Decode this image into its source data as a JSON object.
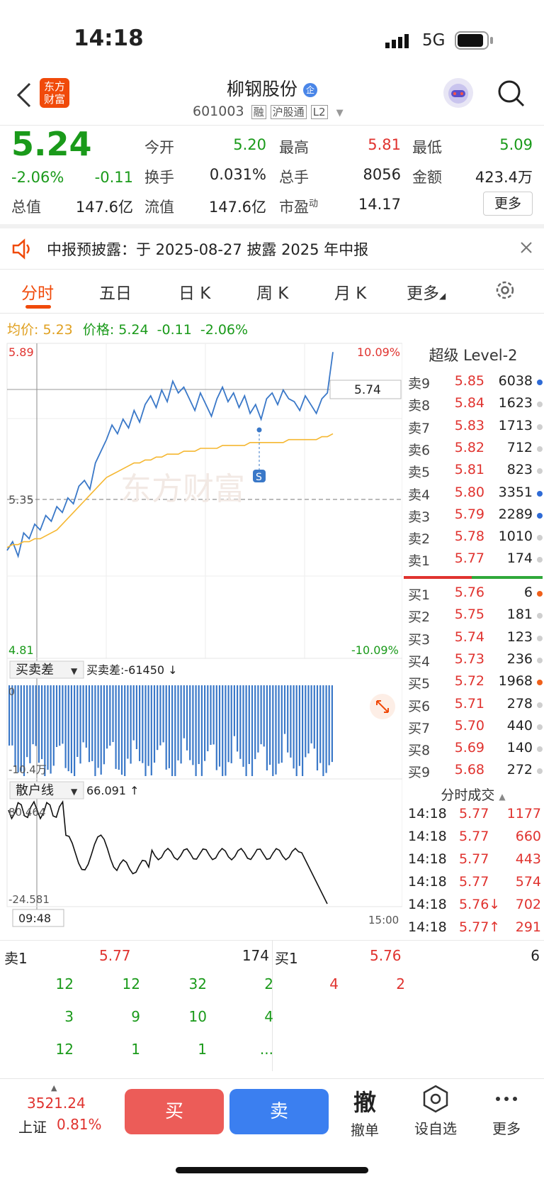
{
  "status": {
    "time": "14:18",
    "network": "5G"
  },
  "header": {
    "title": "柳钢股份",
    "badge": "企",
    "code": "601003",
    "tags": [
      "融",
      "沪股通",
      "L2"
    ],
    "logo_text": "东方\n财富"
  },
  "quote": {
    "price": "5.24",
    "change_pct": "-2.06%",
    "change": "-0.11",
    "open_label": "今开",
    "open": "5.20",
    "high_label": "最高",
    "high": "5.81",
    "low_label": "最低",
    "low": "5.09",
    "turnover_label": "换手",
    "turnover": "0.031%",
    "volume_label": "总手",
    "volume": "8056",
    "amount_label": "金额",
    "amount": "423.4万",
    "mktcap_label": "总值",
    "mktcap": "147.6亿",
    "float_label": "流值",
    "float": "147.6亿",
    "pe_label": "市盈",
    "pe_sup": "动",
    "pe": "14.17",
    "more_label": "更多"
  },
  "notice": {
    "text": "中报预披露：于 2025-08-27 披露 2025 年中报"
  },
  "tabs": [
    "分时",
    "五日",
    "日 K",
    "周 K",
    "月 K",
    "更多"
  ],
  "info_line": {
    "avg_label": "均价:",
    "avg": "5.23",
    "price_label": "价格:",
    "price": "5.24",
    "chg": "-0.11",
    "pct": "-2.06%"
  },
  "chart": {
    "y_top": "5.89",
    "y_mid": "5.35",
    "y_bot": "4.81",
    "pct_top": "10.09%",
    "pct_bot": "-10.09%",
    "cursor_price": "5.74",
    "watermark": "东方财富",
    "s_marker": "S",
    "bsd_label": "买卖差",
    "bsd_value": "买卖差:-61450 ↓",
    "bsd_zero": "0",
    "bsd_min": "-10.4万",
    "retail_label": "散户线",
    "retail_value": "66.091 ↑",
    "retail_max": "80.464",
    "retail_min": "-24.581",
    "time_start": "09:48",
    "time_end": "15:00"
  },
  "chart_data": {
    "type": "line",
    "title": "",
    "ylim": [
      4.81,
      5.89
    ],
    "series": [
      {
        "name": "价格",
        "values": [
          5.18,
          5.21,
          5.16,
          5.24,
          5.22,
          5.27,
          5.25,
          5.3,
          5.28,
          5.33,
          5.31,
          5.36,
          5.34,
          5.4,
          5.42,
          5.39,
          5.48,
          5.52,
          5.56,
          5.61,
          5.58,
          5.63,
          5.6,
          5.66,
          5.62,
          5.68,
          5.71,
          5.67,
          5.73,
          5.69,
          5.76,
          5.72,
          5.74,
          5.7,
          5.66,
          5.72,
          5.68,
          5.64,
          5.7,
          5.74,
          5.69,
          5.72,
          5.67,
          5.71,
          5.65,
          5.68,
          5.63,
          5.7,
          5.72,
          5.68,
          5.73,
          5.7,
          5.69,
          5.66,
          5.71,
          5.68,
          5.65,
          5.7,
          5.72,
          5.86
        ]
      },
      {
        "name": "均价",
        "values": [
          5.19,
          5.2,
          5.2,
          5.21,
          5.21,
          5.22,
          5.22,
          5.23,
          5.24,
          5.25,
          5.27,
          5.29,
          5.31,
          5.33,
          5.35,
          5.37,
          5.39,
          5.41,
          5.43,
          5.44,
          5.45,
          5.46,
          5.47,
          5.48,
          5.48,
          5.49,
          5.49,
          5.5,
          5.5,
          5.51,
          5.51,
          5.51,
          5.52,
          5.52,
          5.52,
          5.53,
          5.53,
          5.53,
          5.53,
          5.54,
          5.54,
          5.54,
          5.54,
          5.54,
          5.55,
          5.55,
          5.55,
          5.55,
          5.55,
          5.55,
          5.55,
          5.56,
          5.56,
          5.56,
          5.56,
          5.56,
          5.56,
          5.57,
          5.57,
          5.58
        ]
      }
    ]
  },
  "book": {
    "title": "超级 Level-2",
    "asks": [
      {
        "label": "卖9",
        "price": "5.85",
        "vol": "6038",
        "dot": "#2f6bd6"
      },
      {
        "label": "卖8",
        "price": "5.84",
        "vol": "1623",
        "dot": "#cfcfcf"
      },
      {
        "label": "卖7",
        "price": "5.83",
        "vol": "1713",
        "dot": "#cfcfcf"
      },
      {
        "label": "卖6",
        "price": "5.82",
        "vol": "712",
        "dot": "#cfcfcf"
      },
      {
        "label": "卖5",
        "price": "5.81",
        "vol": "823",
        "dot": "#cfcfcf"
      },
      {
        "label": "卖4",
        "price": "5.80",
        "vol": "3351",
        "dot": "#2f6bd6"
      },
      {
        "label": "卖3",
        "price": "5.79",
        "vol": "2289",
        "dot": "#2f6bd6"
      },
      {
        "label": "卖2",
        "price": "5.78",
        "vol": "1010",
        "dot": "#cfcfcf"
      },
      {
        "label": "卖1",
        "price": "5.77",
        "vol": "174",
        "dot": "#cfcfcf"
      }
    ],
    "bids": [
      {
        "label": "买1",
        "price": "5.76",
        "vol": "6",
        "dot": "#f0601a"
      },
      {
        "label": "买2",
        "price": "5.75",
        "vol": "181",
        "dot": "#cfcfcf"
      },
      {
        "label": "买3",
        "price": "5.74",
        "vol": "123",
        "dot": "#cfcfcf"
      },
      {
        "label": "买4",
        "price": "5.73",
        "vol": "236",
        "dot": "#cfcfcf"
      },
      {
        "label": "买5",
        "price": "5.72",
        "vol": "1968",
        "dot": "#f0601a"
      },
      {
        "label": "买6",
        "price": "5.71",
        "vol": "278",
        "dot": "#cfcfcf"
      },
      {
        "label": "买7",
        "price": "5.70",
        "vol": "440",
        "dot": "#cfcfcf"
      },
      {
        "label": "买8",
        "price": "5.69",
        "vol": "140",
        "dot": "#cfcfcf"
      },
      {
        "label": "买9",
        "price": "5.68",
        "vol": "272",
        "dot": "#cfcfcf"
      }
    ],
    "trades_title": "分时成交",
    "trades": [
      {
        "time": "14:18",
        "price": "5.77",
        "vol": "1177"
      },
      {
        "time": "14:18",
        "price": "5.77",
        "vol": "660"
      },
      {
        "time": "14:18",
        "price": "5.77",
        "vol": "443"
      },
      {
        "time": "14:18",
        "price": "5.77",
        "vol": "574"
      },
      {
        "time": "14:18",
        "price": "5.76↓",
        "vol": "702"
      },
      {
        "time": "14:18",
        "price": "5.77↑",
        "vol": "291"
      }
    ]
  },
  "queue": {
    "ask_label": "卖1",
    "ask_price": "5.77",
    "ask_vol": "174",
    "bid_label": "买1",
    "bid_price": "5.76",
    "bid_vol": "6",
    "ask_cells": [
      "12",
      "12",
      "32",
      "2",
      "3",
      "9",
      "10",
      "4",
      "12",
      "1",
      "1",
      "..."
    ],
    "bid_cells": [
      "4",
      "2"
    ]
  },
  "footer": {
    "index_value": "3521.24",
    "index_name": "上证",
    "index_pct": "0.81%",
    "buy_label": "买",
    "sell_label": "卖",
    "cancel_icon_text": "撤",
    "cancel_label": "撤单",
    "watch_label": "设自选",
    "more_label": "更多"
  },
  "colors": {
    "up": "#e0332f",
    "down": "#1a9a1a",
    "accent": "#f04a0a",
    "price_line": "#3a78c8",
    "avg_line": "#f5b731"
  }
}
